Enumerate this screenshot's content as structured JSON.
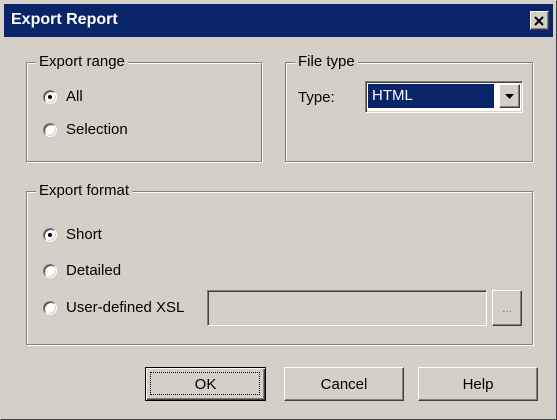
{
  "window": {
    "title": "Export Report"
  },
  "export_range": {
    "legend": "Export range",
    "options": [
      {
        "label": "All",
        "checked": true
      },
      {
        "label": "Selection",
        "checked": false
      }
    ]
  },
  "file_type": {
    "legend": "File type",
    "type_label": "Type:",
    "type_value": "HTML"
  },
  "export_format": {
    "legend": "Export format",
    "options": [
      {
        "label": "Short",
        "checked": true
      },
      {
        "label": "Detailed",
        "checked": false
      },
      {
        "label": "User-defined XSL",
        "checked": false
      }
    ],
    "xsl_path_value": "",
    "browse_label": "..."
  },
  "buttons": {
    "ok": "OK",
    "cancel": "Cancel",
    "help": "Help"
  },
  "icons": {
    "close": "close-icon",
    "dropdown": "chevron-down-icon"
  },
  "colors": {
    "titlebar": "#0a246a",
    "face": "#d4d0c8",
    "selection": "#0a246a"
  }
}
